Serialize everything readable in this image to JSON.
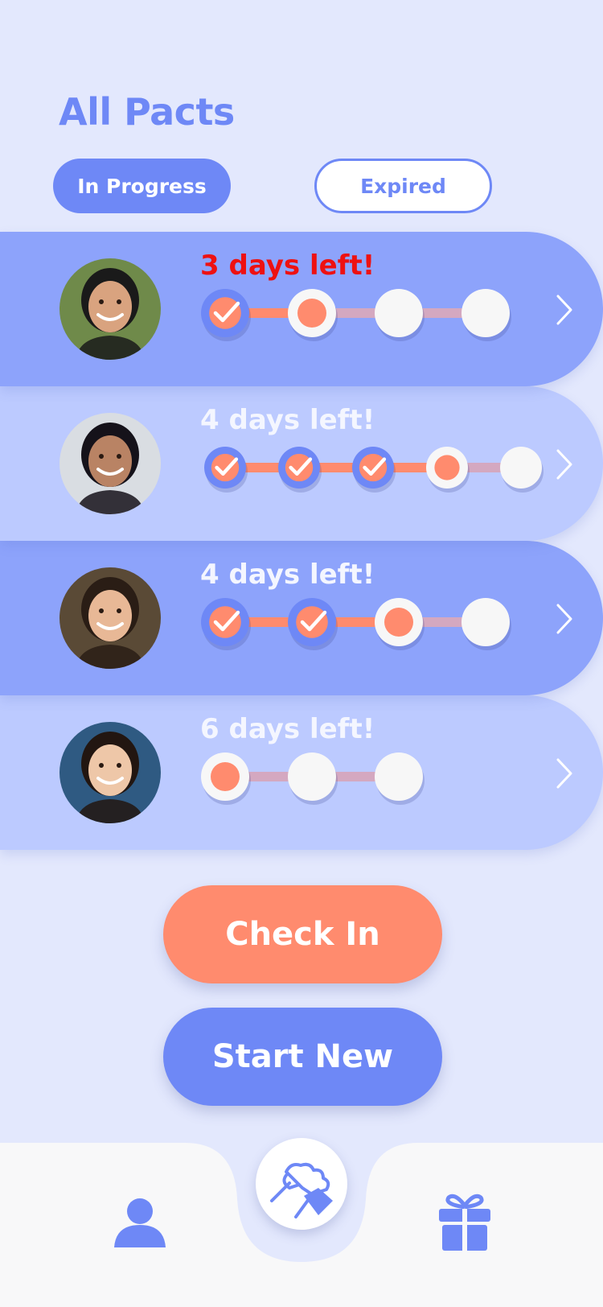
{
  "header": {
    "title": "All Pacts"
  },
  "tabs": [
    {
      "label": "In Progress",
      "active": true
    },
    {
      "label": "Expired",
      "active": false
    }
  ],
  "pacts": [
    {
      "days_left": "3 days left!",
      "urgent": true,
      "total_steps": 4,
      "completed_steps": 1,
      "style": "dark",
      "avatar_skin": "#d9a37f",
      "avatar_hair": "#1a1a1a",
      "avatar_bg": "#6f8a4a"
    },
    {
      "days_left": "4 days left!",
      "urgent": false,
      "total_steps": 5,
      "completed_steps": 3,
      "style": "light",
      "avatar_skin": "#b98364",
      "avatar_hair": "#15121a",
      "avatar_bg": "#d9dde2"
    },
    {
      "days_left": "4 days left!",
      "urgent": false,
      "total_steps": 4,
      "completed_steps": 2,
      "style": "dark",
      "avatar_skin": "#e8b896",
      "avatar_hair": "#2a1d15",
      "avatar_bg": "#5a4a36"
    },
    {
      "days_left": "6 days left!",
      "urgent": false,
      "total_steps": 3,
      "completed_steps": 0,
      "style": "light",
      "avatar_skin": "#eec7a8",
      "avatar_hair": "#221611",
      "avatar_bg": "#2f5a82"
    }
  ],
  "actions": {
    "check_in_label": "Check In",
    "start_new_label": "Start New"
  },
  "nav": {
    "left_icon": "profile-icon",
    "center_icon": "pact-handshake-icon",
    "right_icon": "gift-icon"
  },
  "colors": {
    "accent": "#6e88f6",
    "coral": "#ff8b6e",
    "card_dark": "#8da3fb",
    "card_light": "#bccaff",
    "urgent": "#ee1111"
  }
}
